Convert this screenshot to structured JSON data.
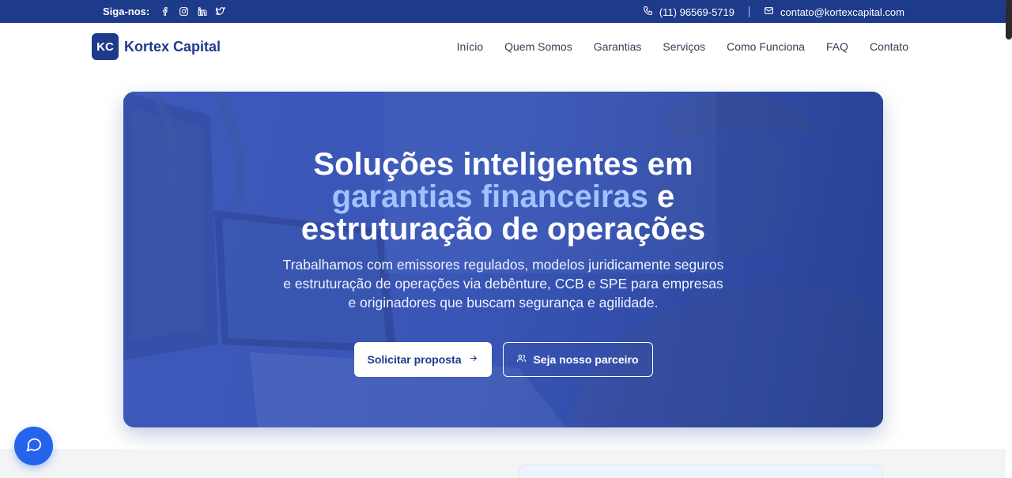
{
  "topbar": {
    "follow_label": "Siga-nos:",
    "social": [
      "facebook-icon",
      "instagram-icon",
      "linkedin-icon",
      "twitter-icon"
    ],
    "phone": "(11) 96569-5719",
    "email": "contato@kortexcapital.com"
  },
  "brand": {
    "badge": "KC",
    "name": "Kortex Capital"
  },
  "nav": {
    "items": [
      "Início",
      "Quem Somos",
      "Garantias",
      "Serviços",
      "Como Funciona",
      "FAQ",
      "Contato"
    ]
  },
  "hero": {
    "title_line1": "Soluções inteligentes em",
    "title_accent": "garantias financeiras",
    "title_after_accent": " e",
    "title_line3": "estruturação de operações",
    "subtitle": "Trabalhamos com emissores regulados, modelos juridicamente seguros e estruturação de operações via debênture, CCB e SPE para empresas e originadores que buscam segurança e agilidade.",
    "primary_button": "Solicitar proposta",
    "secondary_button": "Seja nosso parceiro"
  },
  "colors": {
    "brand": "#1e3a8a",
    "accent": "#9ec4ff",
    "chat": "#2563eb"
  }
}
